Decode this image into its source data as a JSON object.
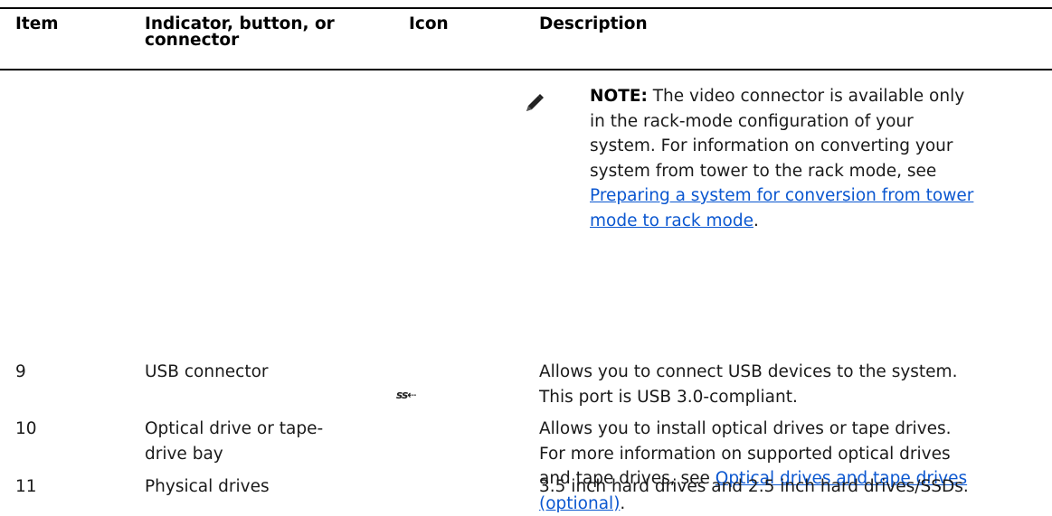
{
  "table": {
    "headers": {
      "item": "Item",
      "indicator": "Indicator, button, or connector",
      "icon": "Icon",
      "description": "Description"
    },
    "note": {
      "icon": "pencil-note-icon",
      "label": "NOTE:",
      "text_lines": [
        " The video connector is available only",
        "in the rack-mode configuration of your",
        "system. For information on converting your",
        "system from tower to the rack mode, see"
      ],
      "link_line1": "Preparing a system for conversion from tower",
      "link_line2": "mode to rack mode",
      "link_suffix": "."
    },
    "rows": [
      {
        "item": "9",
        "name": "USB connector",
        "icon": "usb-3-superspeed-icon",
        "icon_text": "ss⇠",
        "desc_lines": [
          "Allows you to connect USB devices to the system.",
          "This port is USB 3.0-compliant."
        ]
      },
      {
        "item": "10",
        "name_lines": [
          "Optical drive or tape-",
          "drive bay"
        ],
        "desc_lines": [
          "Allows you to install optical drives or tape drives.",
          "For more information on supported optical drives"
        ],
        "desc_prefix": "and tape drives, see ",
        "link_line1": "Optical drives and tape drives",
        "link_line2": "(optional)",
        "link_suffix": "."
      },
      {
        "item": "11",
        "name": "Physical drives",
        "desc": "3.5 inch hard drives and 2.5 inch hard drives/SSDs."
      }
    ]
  }
}
